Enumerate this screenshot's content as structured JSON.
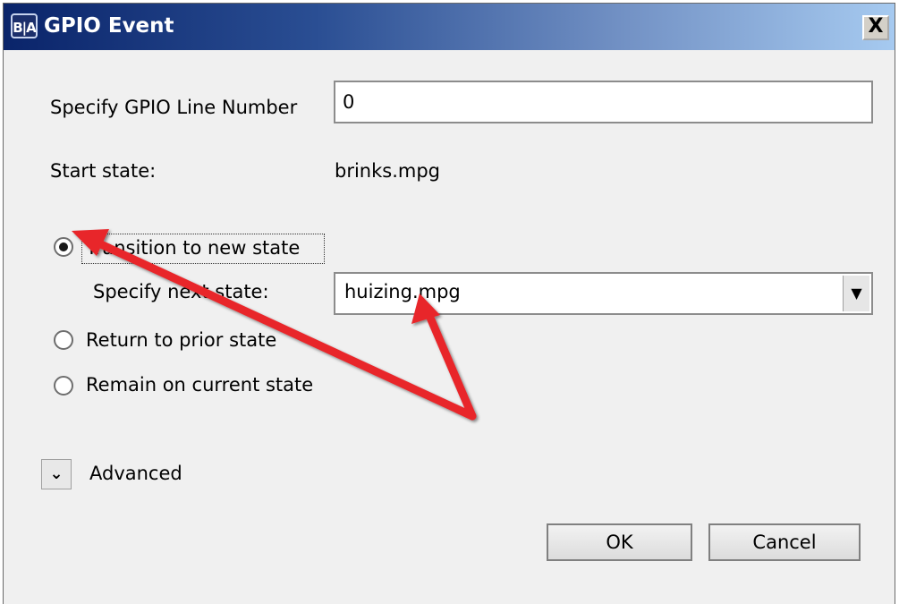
{
  "window": {
    "title": "GPIO Event",
    "app_icon_text": "B|A",
    "close_symbol": "X"
  },
  "gpio_line": {
    "label": "Specify GPIO Line Number",
    "value": "0"
  },
  "start_state": {
    "label": "Start state:",
    "value": "brinks.mpg"
  },
  "options": {
    "transition": {
      "label": "Transition to new state",
      "selected": true
    },
    "next_state": {
      "label": "Specify next state:",
      "value": "huizing.mpg",
      "arrow": "▼"
    },
    "return_prior": {
      "label": "Return to prior state",
      "selected": false
    },
    "remain_current": {
      "label": "Remain on current state",
      "selected": false
    }
  },
  "advanced": {
    "icon": "chevron-down-icon",
    "label": "Advanced",
    "glyph": "⌄"
  },
  "buttons": {
    "ok": "OK",
    "cancel": "Cancel"
  },
  "annotation_color": "#e8262b"
}
